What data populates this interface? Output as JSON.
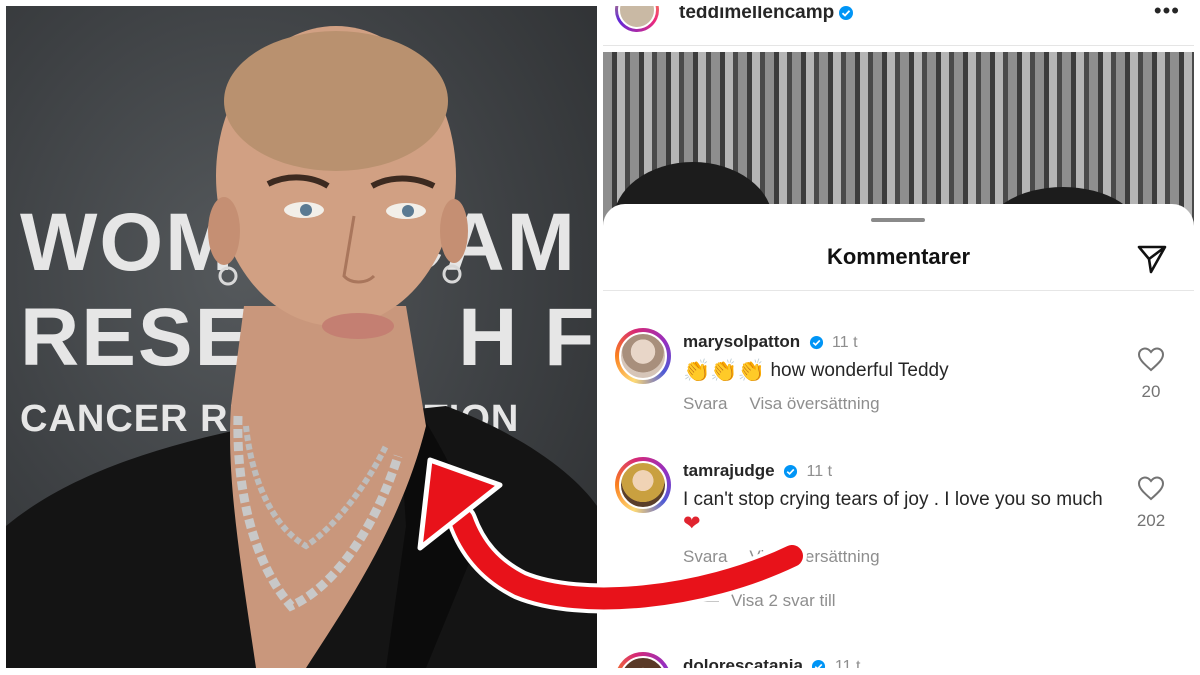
{
  "left_photo": {
    "backdrop_text": {
      "line1": "WOM      CAM",
      "line2": "RESEA      H FU",
      "line3": "CANCER RE          DATION"
    }
  },
  "post": {
    "username": "teddimellencamp",
    "more_icon": "more-horizontal-icon"
  },
  "comments_sheet": {
    "title": "Kommentarer",
    "share_icon": "paper-plane-icon",
    "comments": [
      {
        "username": "marysolpatton",
        "verified": true,
        "time": "11 t",
        "emoji": "👏👏👏",
        "text": "how wonderful Teddy",
        "reply_label": "Svara",
        "translate_label": "Visa översättning",
        "likes": "20"
      },
      {
        "username": "tamrajudge",
        "verified": true,
        "time": "11 t",
        "text": "I can't stop crying tears of joy .  I love you so much",
        "emoji": "❤",
        "reply_label": "Svara",
        "translate_label": "Visa översättning",
        "likes": "202",
        "view_replies": "Visa 2 svar till"
      },
      {
        "username": "dolorescatania",
        "verified": true,
        "time": "11 t"
      }
    ]
  },
  "colors": {
    "arrow": "#e8121a",
    "verified": "#0095f6",
    "backdrop": "#3d4043"
  }
}
